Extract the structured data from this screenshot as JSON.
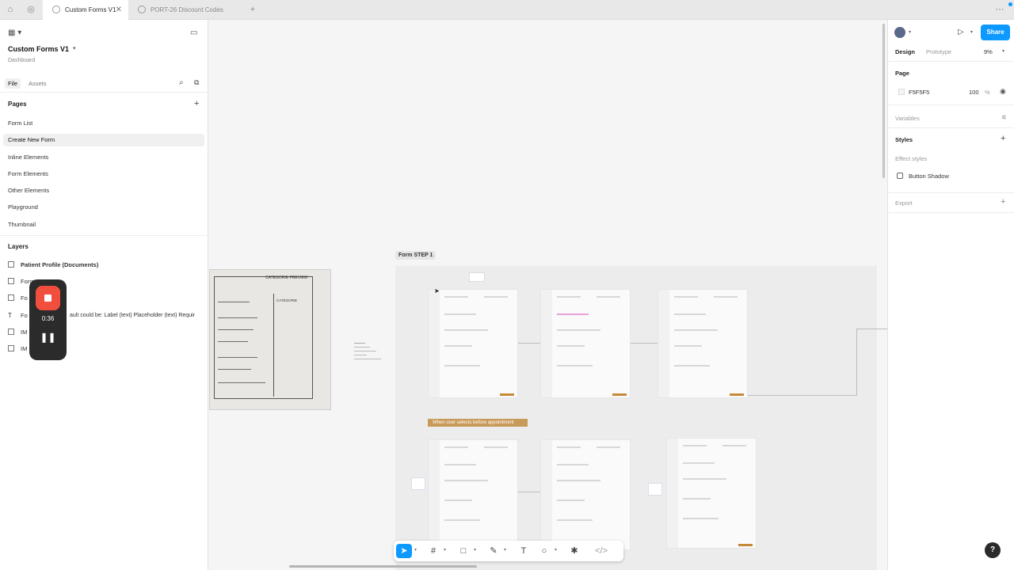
{
  "tabs": [
    {
      "label": "Custom Forms V1",
      "active": true
    },
    {
      "label": "PORT-26 Discount Codes",
      "active": false
    }
  ],
  "file": {
    "name": "Custom Forms V1",
    "project": "Dashboard"
  },
  "left_tabs": {
    "file": "File",
    "assets": "Assets"
  },
  "pages_title": "Pages",
  "pages": [
    {
      "label": "Form List",
      "selected": false
    },
    {
      "label": "Create New Form",
      "selected": true
    },
    {
      "label": "Inline Elements",
      "selected": false
    },
    {
      "label": "Form Elements",
      "selected": false
    },
    {
      "label": "Other Elements",
      "selected": false
    },
    {
      "label": "Playground",
      "selected": false
    },
    {
      "label": "Thumbnail",
      "selected": false
    }
  ],
  "layers_title": "Layers",
  "layers": [
    {
      "label": "Patient Profile (Documents)",
      "icon": "frame-icon",
      "bold": true
    },
    {
      "label": "Form",
      "icon": "frame-icon",
      "bold": false
    },
    {
      "label": "Fo",
      "icon": "frame-icon",
      "bold": false
    },
    {
      "label": "Fo",
      "icon": "text-icon",
      "bold": false
    },
    {
      "label": "IM",
      "icon": "image-icon",
      "bold": false
    },
    {
      "label": "IM",
      "icon": "image-icon",
      "bold": false
    }
  ],
  "layer_overflow_text": "ault could be: Label (text) Placeholder (text) Requir",
  "recorder": {
    "time": "0:36"
  },
  "right": {
    "design": "Design",
    "prototype": "Prototype",
    "zoom": "9%",
    "share": "Share",
    "page_title": "Page",
    "page_color": "F5F5F5",
    "page_opacity": "100",
    "page_opacity_unit": "%",
    "variables": "Variables",
    "styles": "Styles",
    "effect_styles": "Effect styles",
    "button_shadow": "Button Shadow",
    "export": "Export"
  },
  "canvas": {
    "frame_label": "Form STEP 1",
    "banner": "When user selects before appointment",
    "sketch_title": "CATEGORIE   PREVIEW",
    "sketch_sub": "CATEGORIE"
  },
  "colors": {
    "accent": "#0d99ff",
    "record": "#f24e3e",
    "orange": "#c48a3a"
  }
}
